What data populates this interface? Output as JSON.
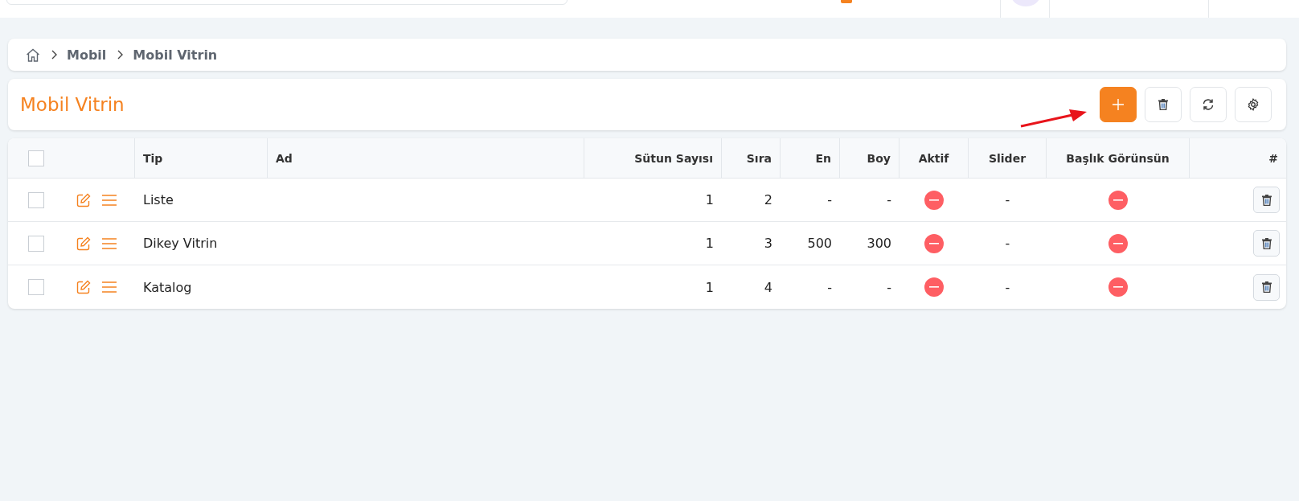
{
  "breadcrumb": [
    "Mobil",
    "Mobil Vitrin"
  ],
  "page_title": "Mobil Vitrin",
  "table": {
    "columns": [
      "Tip",
      "Ad",
      "Sütun Sayısı",
      "Sıra",
      "En",
      "Boy",
      "Aktif",
      "Slider",
      "Başlık Görünsün",
      "#"
    ],
    "header_checked": false,
    "rows": [
      {
        "checked": false,
        "tip": "Liste",
        "ad": "",
        "sutun": "1",
        "sira": "2",
        "en": "-",
        "boy": "-",
        "aktif": false,
        "slider": "-",
        "baslik": false
      },
      {
        "checked": false,
        "tip": "Dikey Vitrin",
        "ad": "",
        "sutun": "1",
        "sira": "3",
        "en": "500",
        "boy": "300",
        "aktif": false,
        "slider": "-",
        "baslik": false
      },
      {
        "checked": false,
        "tip": "Katalog",
        "ad": "",
        "sutun": "1",
        "sira": "4",
        "en": "-",
        "boy": "-",
        "aktif": false,
        "slider": "-",
        "baslik": false
      }
    ]
  }
}
